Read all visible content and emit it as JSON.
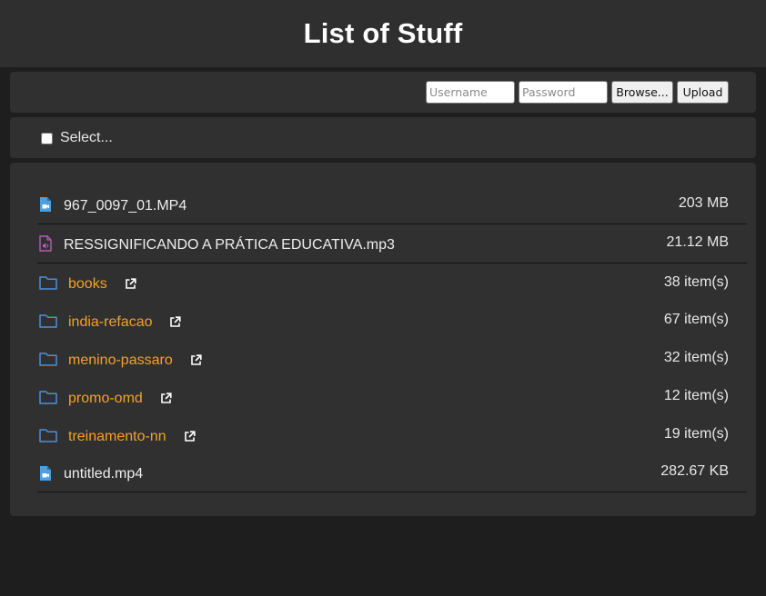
{
  "header": {
    "title": "List of Stuff"
  },
  "upload": {
    "username_placeholder": "Username",
    "password_placeholder": "Password",
    "browse_label": "Browse...",
    "upload_label": "Upload"
  },
  "select": {
    "label": "Select..."
  },
  "colors": {
    "file_icon": "#4aa0e0",
    "audio_icon": "#b35db8",
    "folder_icon": "#4a90d9",
    "folder_link": "#f0a22a"
  },
  "files": [
    {
      "name": "967_0097_01.MP4",
      "size": "203 MB",
      "icon": "video-file-icon"
    },
    {
      "name": "RESSIGNIFICANDO A PRÁTICA EDUCATIVA.mp3",
      "size": "21.12 MB",
      "icon": "audio-file-icon"
    },
    {
      "name": "books",
      "size": "38 item(s)",
      "icon": "folder-icon"
    },
    {
      "name": "india-refacao",
      "size": "67 item(s)",
      "icon": "folder-icon"
    },
    {
      "name": "menino-passaro",
      "size": "32 item(s)",
      "icon": "folder-icon"
    },
    {
      "name": "promo-omd",
      "size": "12 item(s)",
      "icon": "folder-icon"
    },
    {
      "name": "treinamento-nn",
      "size": "19 item(s)",
      "icon": "folder-icon"
    },
    {
      "name": "untitled.mp4",
      "size": "282.67 KB",
      "icon": "video-file-icon"
    }
  ]
}
